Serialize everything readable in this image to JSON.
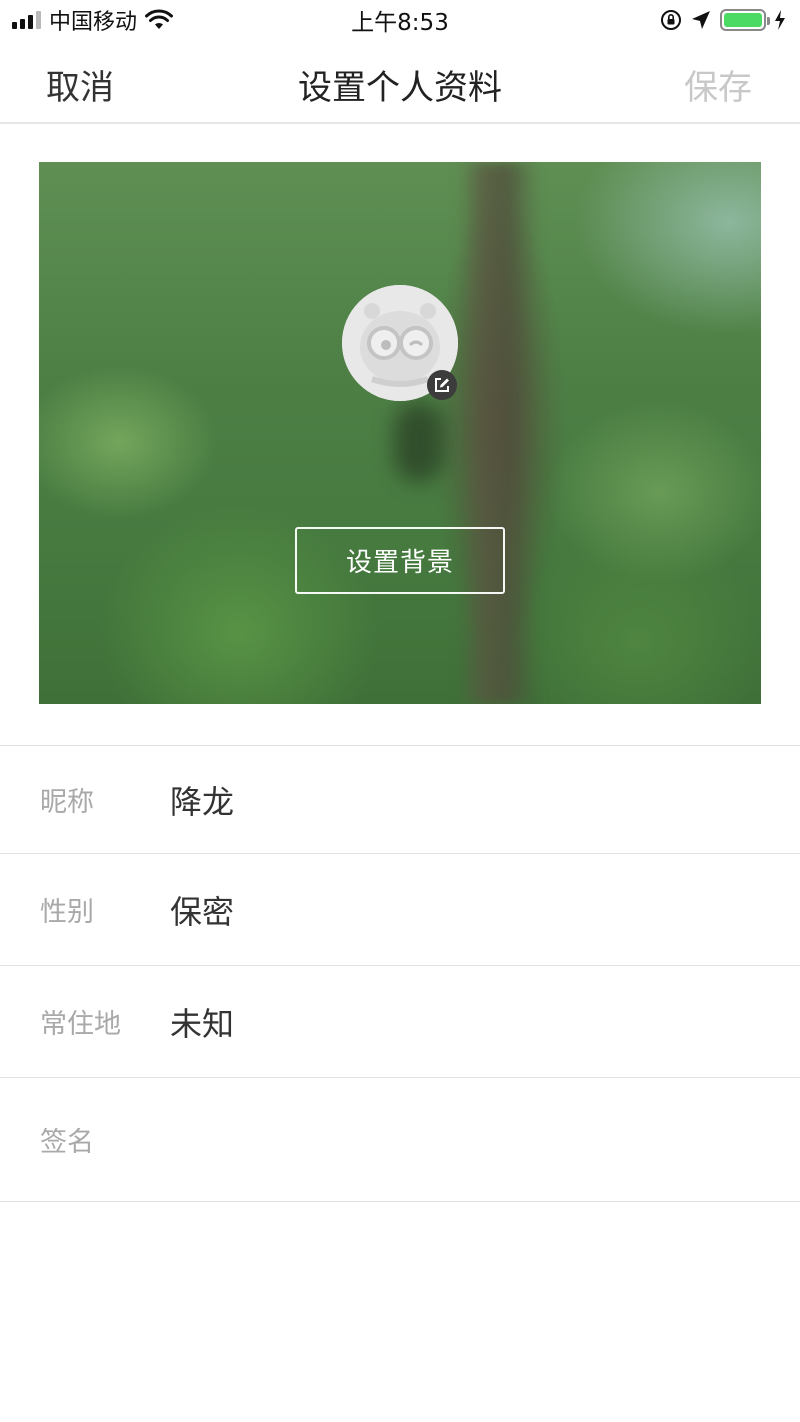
{
  "status_bar": {
    "carrier": "中国移动",
    "time": "上午8:53",
    "battery_level": 1.0,
    "icons": [
      "cellular-signal-icon",
      "wifi-icon",
      "orientation-lock-icon",
      "location-arrow-icon",
      "battery-icon",
      "charging-bolt-icon"
    ]
  },
  "nav": {
    "cancel": "取消",
    "title": "设置个人资料",
    "save": "保存"
  },
  "cover": {
    "set_background": "设置背景",
    "avatar_icon": "default-avatar-icon",
    "edit_icon": "edit-icon"
  },
  "form": {
    "nickname": {
      "label": "昵称",
      "value": "降龙"
    },
    "gender": {
      "label": "性别",
      "value": "保密"
    },
    "location": {
      "label": "常住地",
      "value": "未知"
    },
    "signature": {
      "label": "签名",
      "value": ""
    }
  },
  "colors": {
    "save_disabled": "#c8c8c8",
    "label_gray": "#a9a9a9",
    "battery_green": "#4cd964"
  }
}
